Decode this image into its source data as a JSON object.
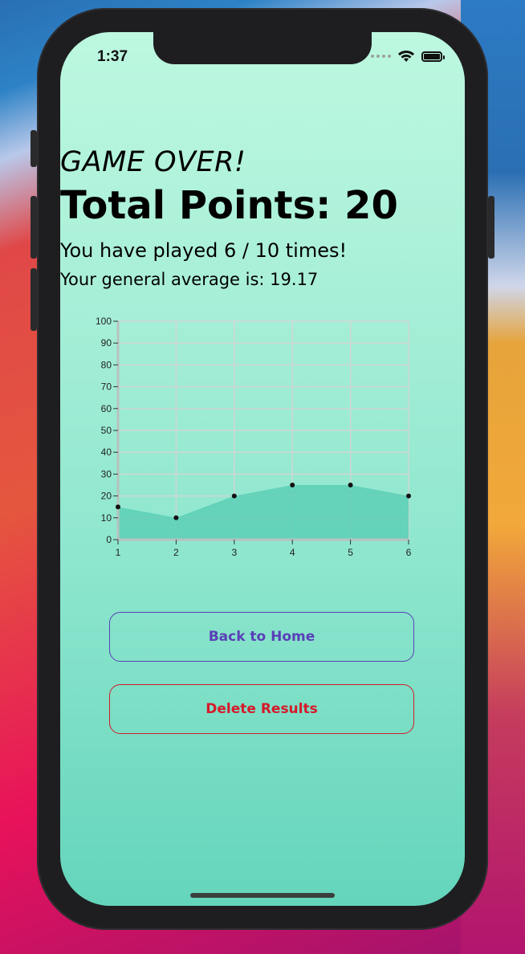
{
  "status_bar": {
    "time": "1:37"
  },
  "screen": {
    "heading": "GAME OVER!",
    "total_points": "Total Points: 20",
    "played": "You have played 6 / 10 times!",
    "average": "Your general average is: 19.17"
  },
  "buttons": {
    "back_home": "Back to Home",
    "delete_results": "Delete Results"
  },
  "colors": {
    "back_home": "#5a3fb8",
    "delete_results": "#d51a2a",
    "area_fill": "#5ccfb6"
  },
  "chart_data": {
    "type": "area",
    "x": [
      1,
      2,
      3,
      4,
      5,
      6
    ],
    "values": [
      15,
      10,
      20,
      25,
      25,
      20
    ],
    "ylim": [
      0,
      100
    ],
    "yticks": [
      0,
      10,
      20,
      30,
      40,
      50,
      60,
      70,
      80,
      90,
      100
    ],
    "xticks": [
      1,
      2,
      3,
      4,
      5,
      6
    ],
    "grid": true
  }
}
